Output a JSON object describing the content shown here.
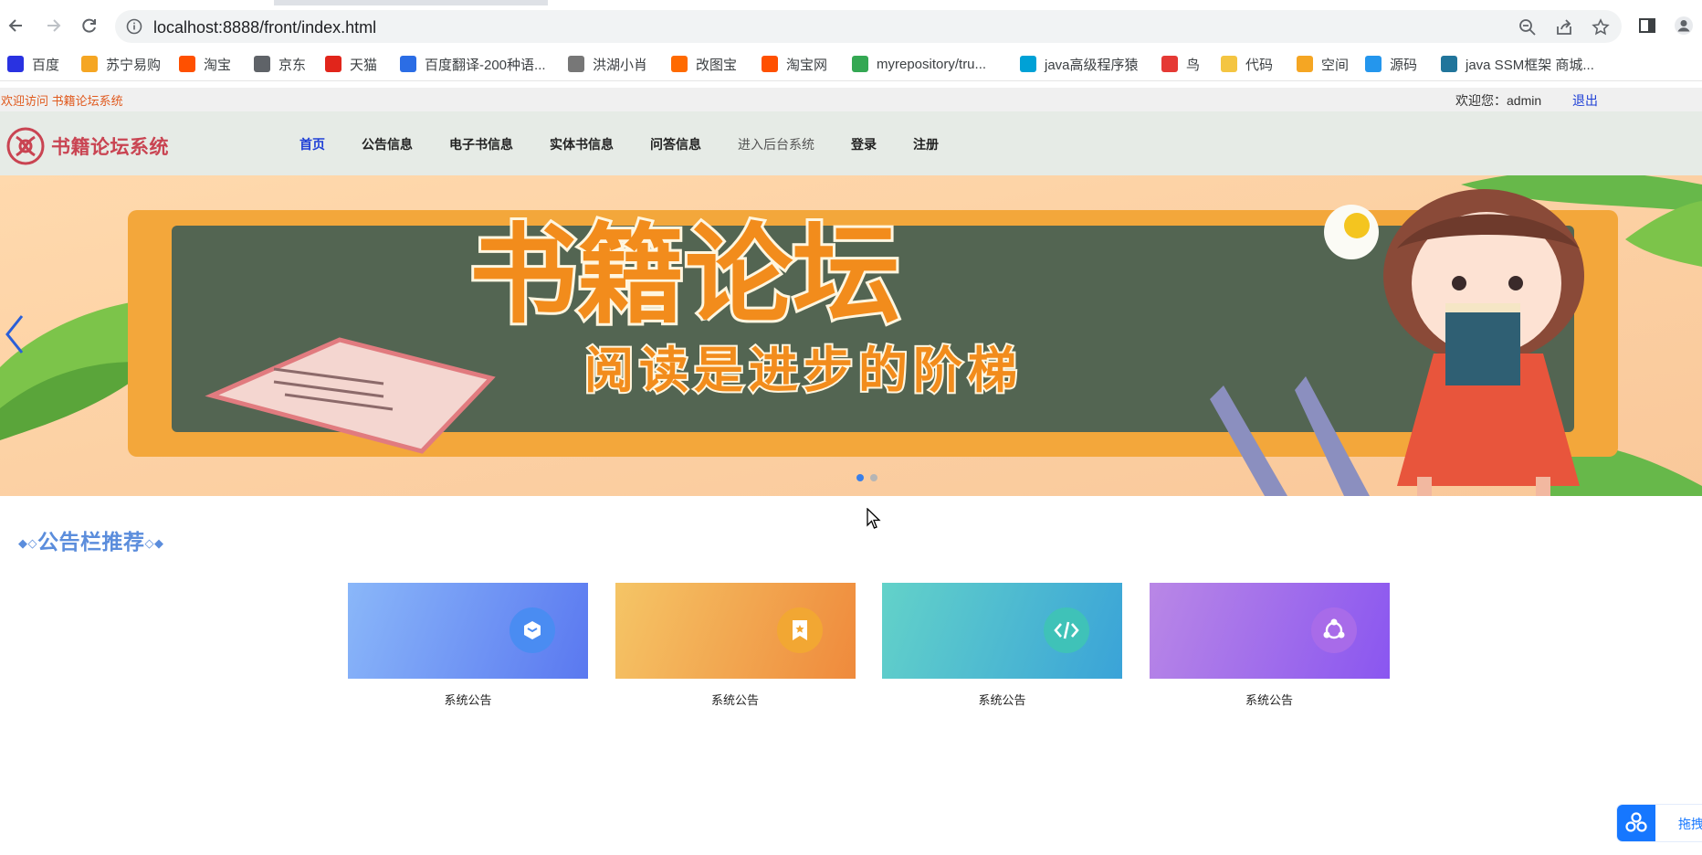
{
  "browser": {
    "url": "localhost:8888/front/index.html",
    "bookmarks": [
      {
        "label": "百度",
        "icon": "baidu-icon",
        "color": "#2932e1"
      },
      {
        "label": "苏宁易购",
        "icon": "suning-icon",
        "color": "#f5a623"
      },
      {
        "label": "淘宝",
        "icon": "taobao-icon",
        "color": "#ff5000"
      },
      {
        "label": "京东",
        "icon": "globe-icon",
        "color": "#5f6368"
      },
      {
        "label": "天猫",
        "icon": "tmall-icon",
        "color": "#e1251b"
      },
      {
        "label": "百度翻译-200种语...",
        "icon": "fanyi-icon",
        "color": "#2b6de5"
      },
      {
        "label": "洪湖小肖",
        "icon": "feather-icon",
        "color": "#777777"
      },
      {
        "label": "改图宝",
        "icon": "gaitubao-icon",
        "color": "#ff6a00"
      },
      {
        "label": "淘宝网",
        "icon": "taobao-icon",
        "color": "#ff5000"
      },
      {
        "label": "myrepository/tru...",
        "icon": "chrome-icon",
        "color": "#34a853"
      },
      {
        "label": "java高级程序猿",
        "icon": "bilibili-icon",
        "color": "#00a1d6"
      },
      {
        "label": "鸟",
        "icon": "bird-icon",
        "color": "#e53935"
      },
      {
        "label": "代码",
        "icon": "moon-icon",
        "color": "#f4c542"
      },
      {
        "label": "空间",
        "icon": "qzone-icon",
        "color": "#f5a623"
      },
      {
        "label": "源码",
        "icon": "docker-icon",
        "color": "#2496ed"
      },
      {
        "label": "java SSM框架 商城...",
        "icon": "wordpress-icon",
        "color": "#21759b"
      }
    ]
  },
  "site": {
    "welcome": "欢迎访问 书籍论坛系统",
    "user_greeting": "欢迎您：admin",
    "logout": "退出",
    "brand": "书籍论坛系统",
    "menu": [
      {
        "label": "首页",
        "state": "active"
      },
      {
        "label": "公告信息",
        "state": ""
      },
      {
        "label": "电子书信息",
        "state": ""
      },
      {
        "label": "实体书信息",
        "state": ""
      },
      {
        "label": "问答信息",
        "state": ""
      },
      {
        "label": "进入后台系统",
        "state": "muted"
      },
      {
        "label": "登录",
        "state": ""
      },
      {
        "label": "注册",
        "state": ""
      }
    ],
    "banner": {
      "title": "书籍论坛",
      "subtitle": "阅读是进步的阶梯",
      "slides": 2,
      "active_slide": 1
    },
    "section_title": "公告栏推荐",
    "notices": [
      {
        "label": "系统公告",
        "icon": "cube-icon",
        "from": "#8ab7f9",
        "to": "#5a78f0",
        "icon_bg": "#4a8cf2"
      },
      {
        "label": "系统公告",
        "icon": "bookmark-star-icon",
        "from": "#f5c566",
        "to": "#ef8a3c",
        "icon_bg": "#f2a733"
      },
      {
        "label": "系统公告",
        "icon": "code-icon",
        "from": "#63d2c9",
        "to": "#3aa3d8",
        "icon_bg": "#3fc2b8"
      },
      {
        "label": "系统公告",
        "icon": "share-nodes-icon",
        "from": "#b987e6",
        "to": "#8a56f0",
        "icon_bg": "#a86be9"
      }
    ],
    "floating_widget": "拖拽"
  }
}
